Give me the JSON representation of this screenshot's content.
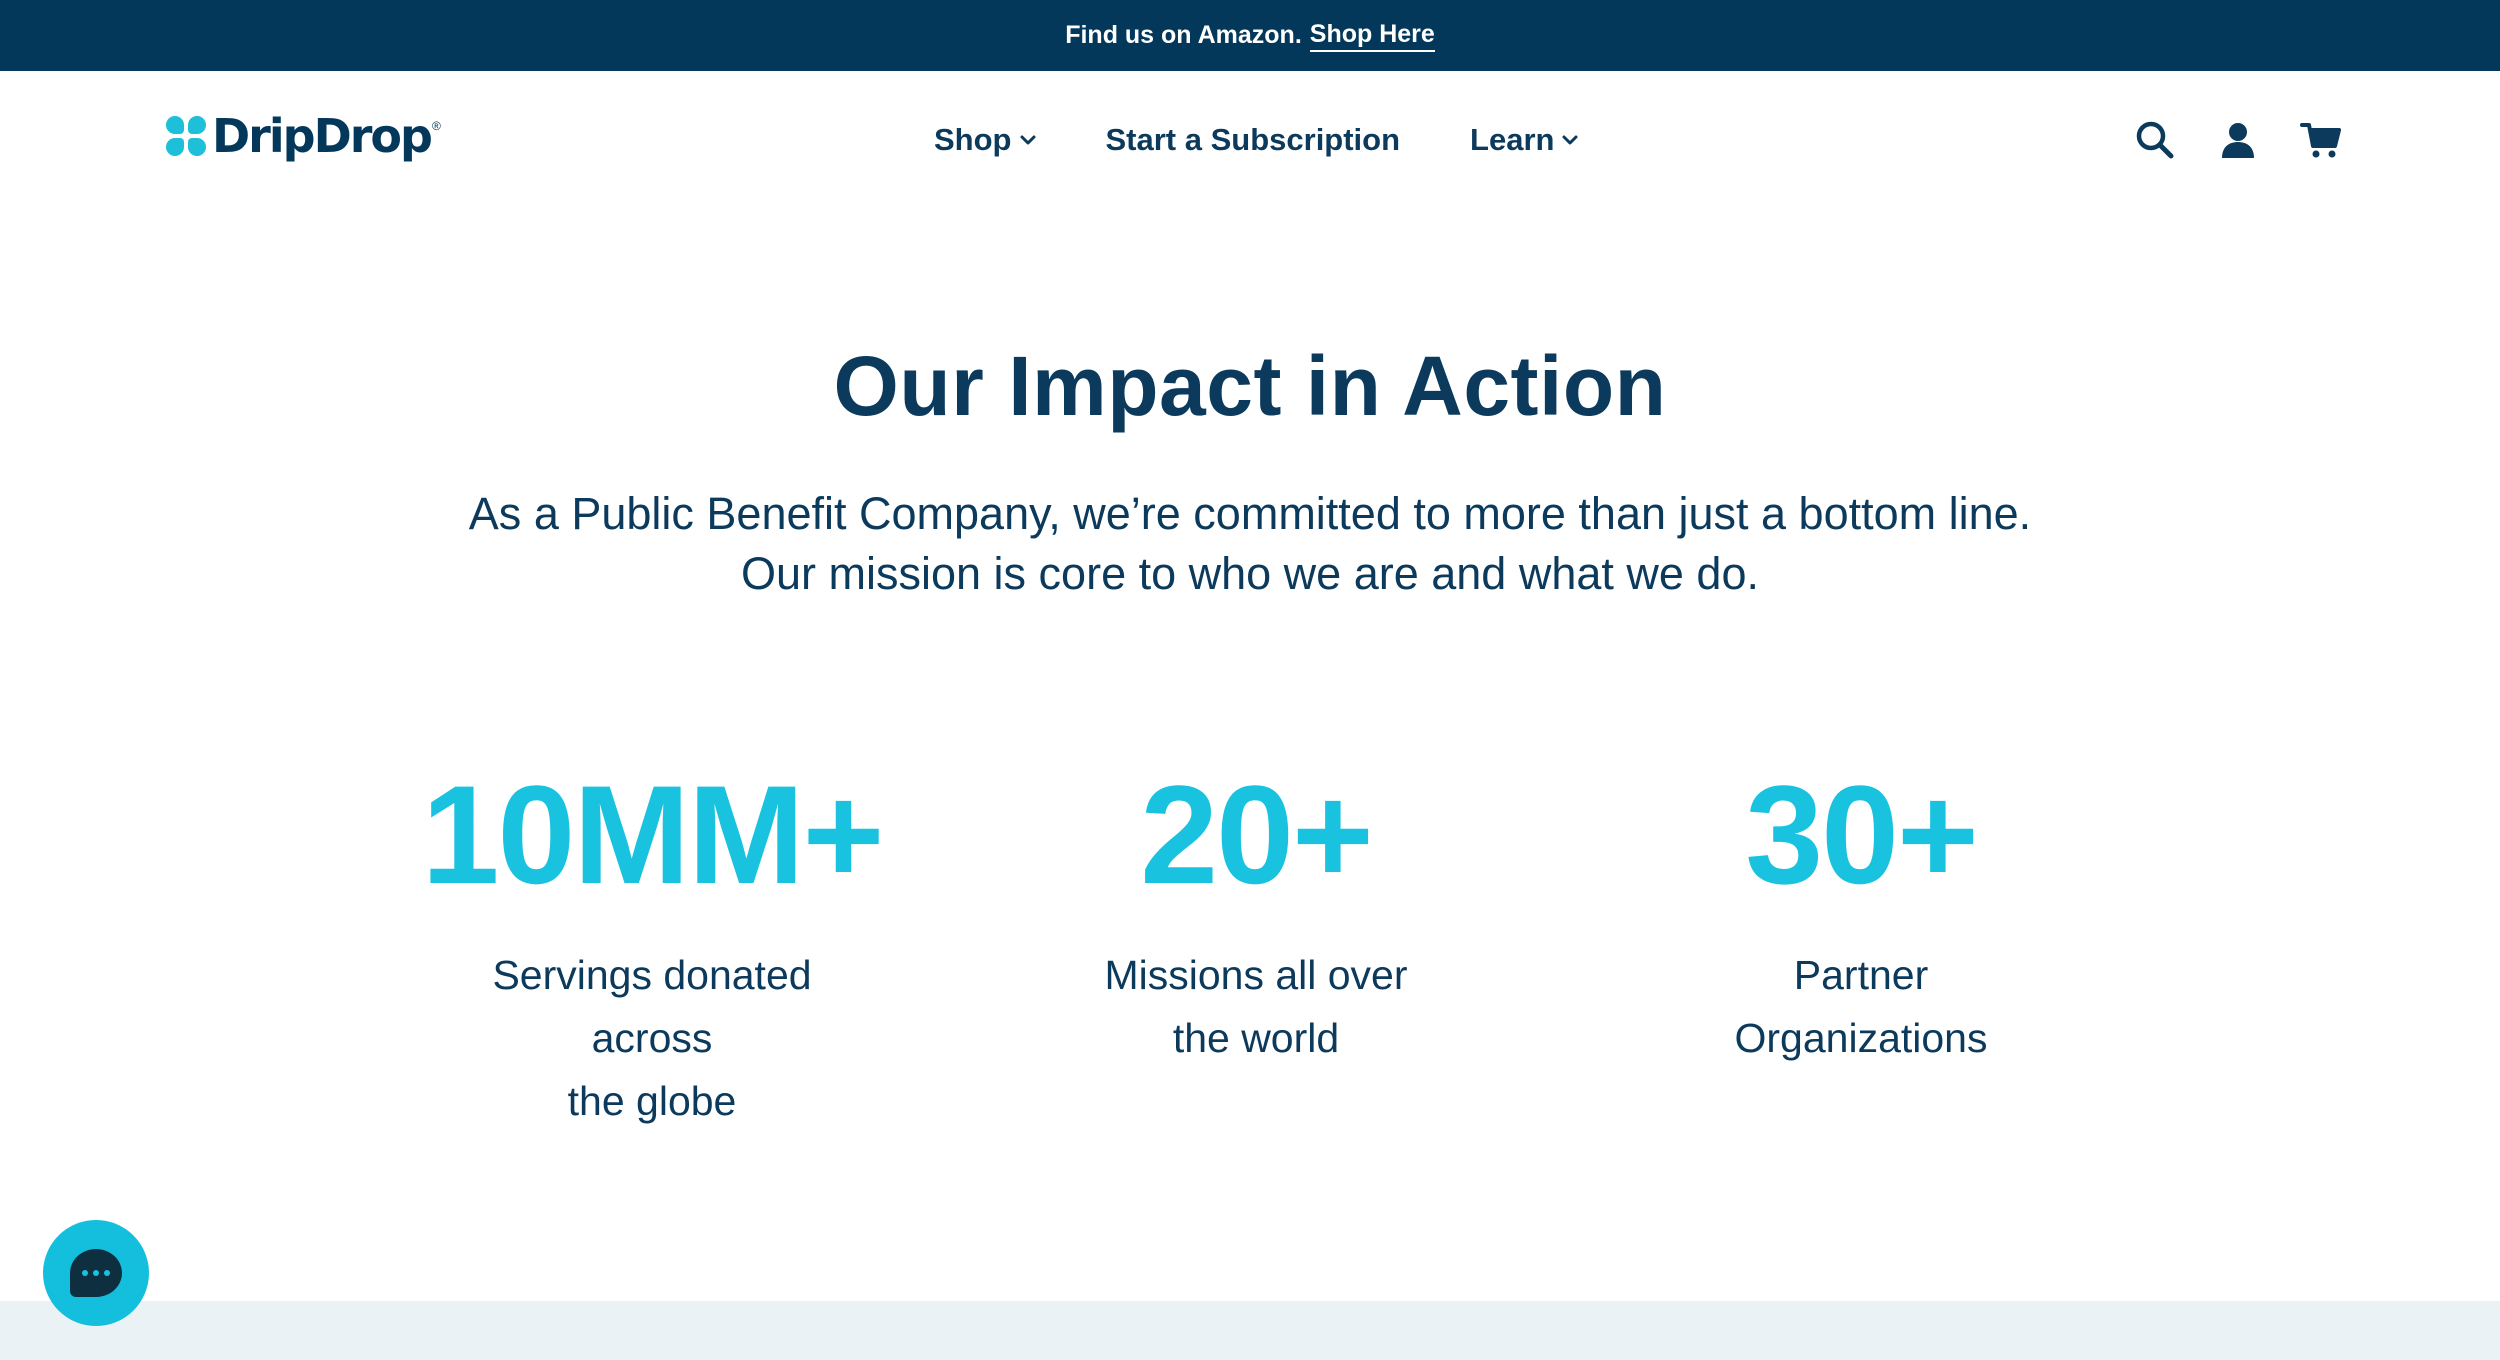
{
  "announcement": {
    "text": "Find us on Amazon.",
    "link_label": "Shop Here"
  },
  "header": {
    "logo": "DripDrop",
    "logo_mark": "®",
    "nav": [
      {
        "label": "Shop",
        "has_dropdown": true
      },
      {
        "label": "Start a Subscription",
        "has_dropdown": false
      },
      {
        "label": "Learn",
        "has_dropdown": true
      }
    ],
    "icons": [
      "search-icon",
      "account-icon",
      "cart-icon"
    ]
  },
  "hero": {
    "title": "Our Impact in Action",
    "subtitle_line1": "As a Public Benefit Company, we’re committed to more than just a bottom line.",
    "subtitle_line2": "Our mission is core to who we are and what we do."
  },
  "stats": [
    {
      "value": "10MM+",
      "label_lines": [
        "Servings donated",
        "across",
        "the globe"
      ]
    },
    {
      "value": "20+",
      "label_lines": [
        "Missions all over",
        "the world"
      ]
    },
    {
      "value": "30+",
      "label_lines": [
        "Partner",
        "Organizations"
      ]
    }
  ],
  "colors": {
    "navy": "#03385b",
    "text": "#0c3a5c",
    "accent": "#19c3df",
    "strip": "#ebf2f5"
  },
  "chat": {
    "icon": "chat-bubble-icon"
  }
}
